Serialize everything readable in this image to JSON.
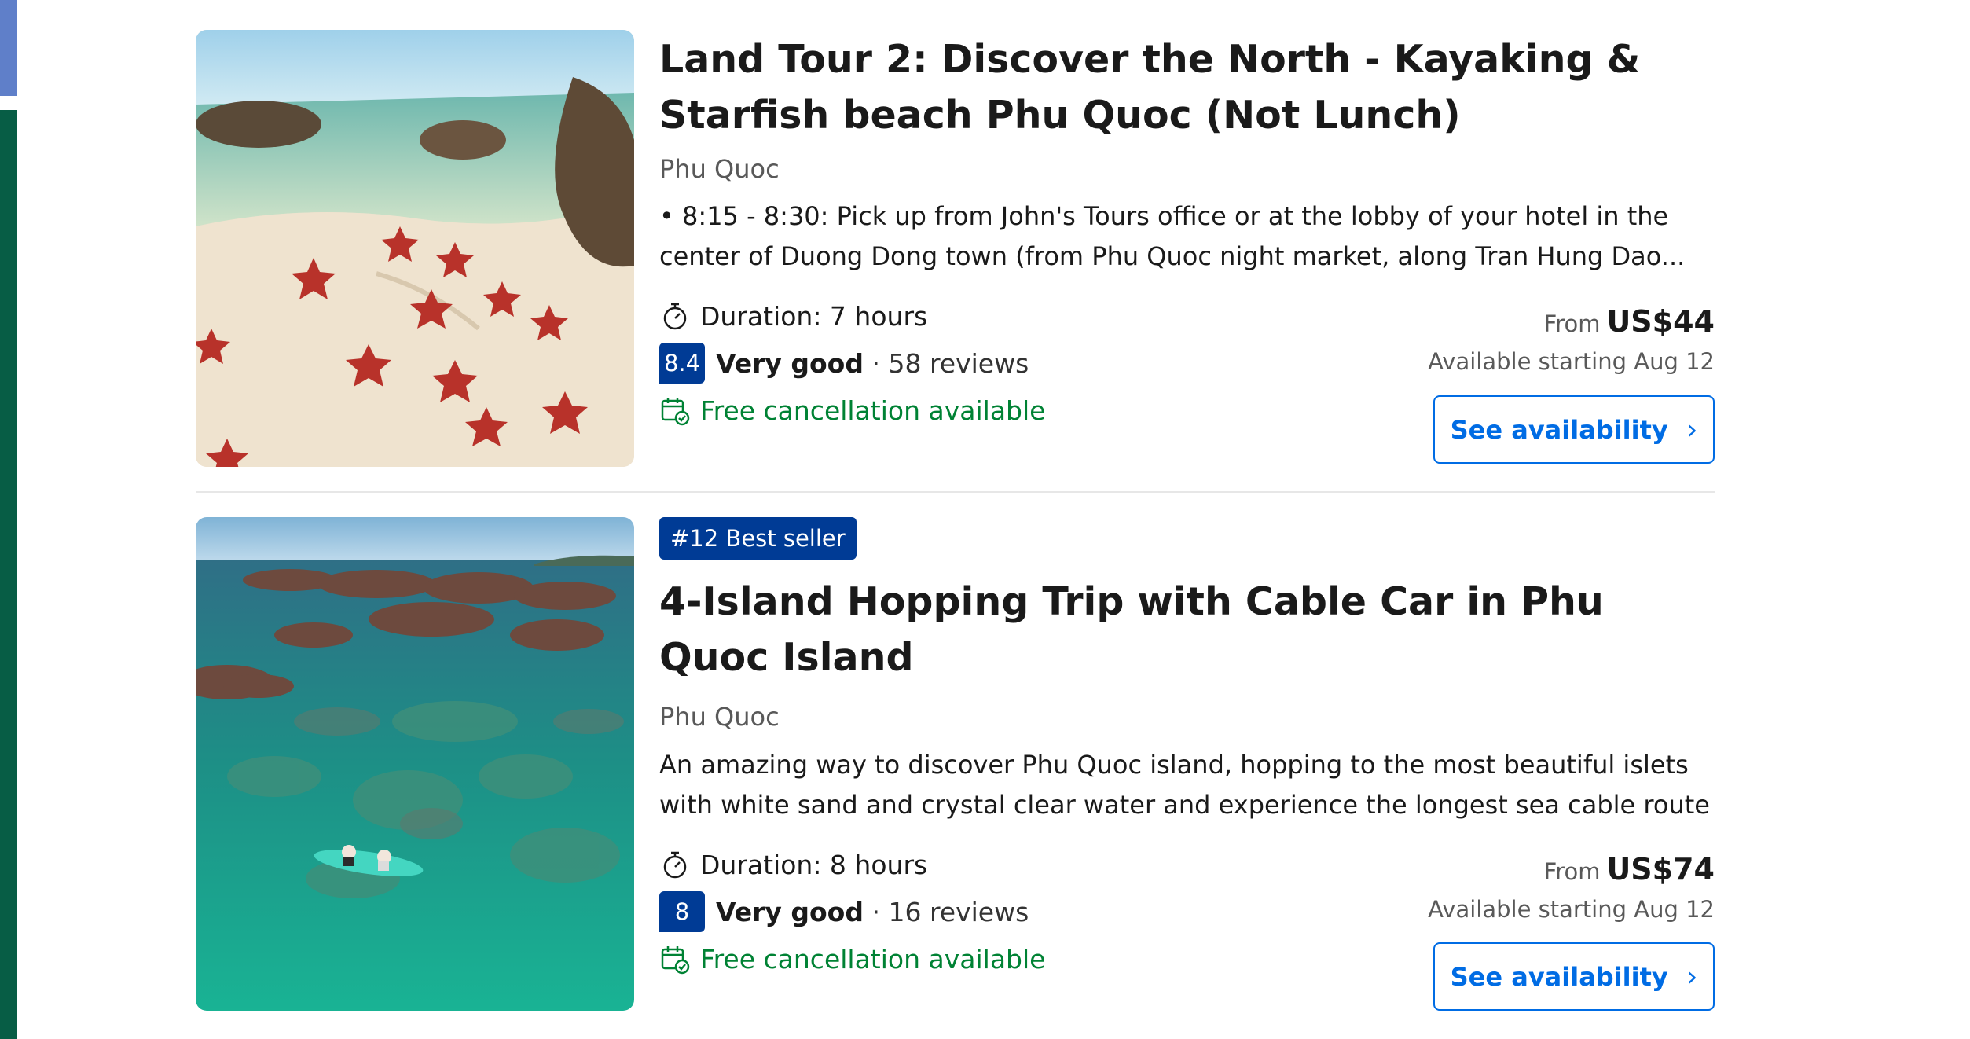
{
  "listings": [
    {
      "badge": "",
      "title": "Land Tour 2: Discover the North - Kayaking & Starfish beach Phu Quoc (Not Lunch)",
      "location": "Phu Quoc",
      "description_line1": "• 8:15 - 8:30: Pick up from John's Tours office or at the lobby of your hotel in the",
      "description_line2": "center of Duong Dong town (from Phu Quoc night market, along Tran Hung Dao...",
      "duration": "Duration: 7 hours",
      "score": "8.4",
      "rating_word": "Very good",
      "reviews": "· 58 reviews",
      "cancellation": "Free cancellation available",
      "price_prefix": "From",
      "price": "US$44",
      "availability": "Available starting Aug 12",
      "cta_label": "See availability",
      "image_icon": "starfish-beach-photo"
    },
    {
      "badge": "#12 Best seller",
      "title": "4-Island Hopping Trip with Cable Car in Phu Quoc Island",
      "location": "Phu Quoc",
      "description_line1": "An amazing way to discover Phu Quoc island, hopping to the most beautiful islets",
      "description_line2": "with white sand and crystal clear water and experience the longest sea cable route in...",
      "duration": "Duration: 8 hours",
      "score": "8",
      "rating_word": "Very good",
      "reviews": "· 16 reviews",
      "cancellation": "Free cancellation available",
      "price_prefix": "From",
      "price": "US$74",
      "availability": "Available starting Aug 12",
      "cta_label": "See availability",
      "image_icon": "kayak-reef-photo"
    }
  ],
  "colors": {
    "brand_blue": "#003b95",
    "link_blue": "#006ce4",
    "success_green": "#008234",
    "sidebar_blue": "#5f7fc9",
    "sidebar_green": "#075d45"
  },
  "icons": {
    "duration": "stopwatch-icon",
    "cancellation": "calendar-check-icon",
    "cta": "chevron-right-icon"
  }
}
